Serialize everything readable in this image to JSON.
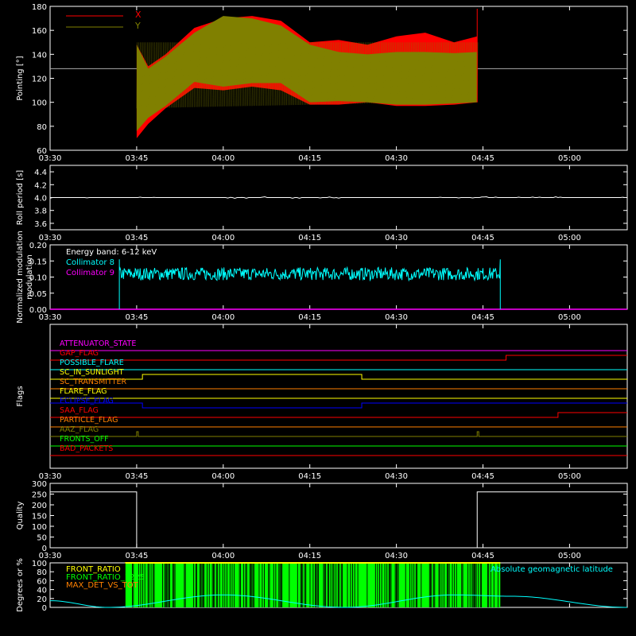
{
  "x_tick_labels": [
    "03:30",
    "03:45",
    "04:00",
    "04:15",
    "04:30",
    "04:45",
    "05:00"
  ],
  "colors": {
    "x_series": "#ff0000",
    "y_series": "#808000",
    "axis": "#ffffff",
    "collimator_8": "#00ffff",
    "collimator_9": "#ff00ff",
    "latitude": "#00ffff",
    "front_ratio": "#ffff00",
    "front_ratio_1225": "#00ff00",
    "max_det_vs_tot": "#ff8000"
  },
  "chart_data": [
    {
      "type": "line",
      "ylabel": "Pointing [°]",
      "ylim": [
        60,
        180
      ],
      "y_ticks": [
        "60",
        "80",
        "100",
        "120",
        "140",
        "160",
        "180"
      ],
      "x": [
        "03:30",
        "05:10"
      ],
      "reference_line": 128,
      "legend": [
        "X",
        "Y"
      ],
      "series": [
        {
          "name": "X",
          "x": [
            "03:45",
            "03:47",
            "03:50",
            "03:55",
            "04:00",
            "04:05",
            "04:10",
            "04:15",
            "04:20",
            "04:25",
            "04:30",
            "04:35",
            "04:40",
            "04:44"
          ],
          "upper": [
            148,
            130,
            140,
            162,
            170,
            172,
            168,
            150,
            152,
            148,
            155,
            158,
            150,
            155
          ],
          "lower": [
            70,
            82,
            95,
            112,
            110,
            113,
            110,
            98,
            98,
            100,
            97,
            97,
            98,
            100
          ]
        },
        {
          "name": "Y",
          "x": [
            "03:45",
            "03:47",
            "03:50",
            "03:55",
            "04:00",
            "04:05",
            "04:10",
            "04:15",
            "04:20",
            "04:25",
            "04:30",
            "04:35",
            "04:40",
            "04:44"
          ],
          "upper": [
            148,
            128,
            138,
            158,
            172,
            170,
            164,
            148,
            142,
            140,
            142,
            142,
            141,
            142
          ],
          "lower": [
            76,
            87,
            97,
            117,
            113,
            116,
            116,
            100,
            101,
            100,
            98,
            98,
            99,
            100
          ]
        }
      ]
    },
    {
      "type": "line",
      "ylabel": "Roll period [s]",
      "ylim": [
        3.5,
        4.5
      ],
      "y_ticks": [
        "3.6",
        "3.8",
        "4.0",
        "4.2",
        "4.4"
      ],
      "series": [
        {
          "x": [
            "03:30",
            "05:10"
          ],
          "values": [
            4.0,
            4.0
          ]
        }
      ]
    },
    {
      "type": "line",
      "ylabel": "Normalized modulation",
      "ylim": [
        0,
        0.2
      ],
      "y_ticks": [
        "0.00",
        "0.05",
        "0.10",
        "0.15",
        "0.20"
      ],
      "annotation": "Energy band: 6-12 keV",
      "series": [
        {
          "name": "Collimator 8",
          "x_start": "03:42",
          "x_end": "04:48",
          "mean": 0.11,
          "spread": 0.02
        },
        {
          "name": "Collimator 9",
          "value": 0.0
        }
      ]
    },
    {
      "type": "line",
      "ylabel": "Flags",
      "flags": [
        {
          "name": "ATTENUATOR_STATE",
          "color": "#ff00ff",
          "steps": [
            [
              0,
              0
            ]
          ]
        },
        {
          "name": "GAP_FLAG",
          "color": "#ff0000",
          "steps": [
            [
              0,
              0
            ],
            [
              1.0,
              1
            ]
          ]
        },
        {
          "name": "POSSIBLE_FLARE",
          "color": "#00ffff",
          "steps": [
            [
              0,
              0
            ]
          ]
        },
        {
          "name": "SC_IN_SUNLIGHT",
          "color": "#ffff00",
          "steps": [
            [
              0,
              0
            ],
            [
              0.3,
              1
            ],
            [
              0.8,
              0
            ]
          ]
        },
        {
          "name": "SC_TRANSMITTER",
          "color": "#ff8000",
          "steps": [
            [
              0,
              0
            ]
          ]
        },
        {
          "name": "FLARE_FLAG",
          "color": "#ffff00",
          "steps": [
            [
              0,
              0
            ]
          ]
        },
        {
          "name": "ECLIPSE_FLAG",
          "color": "#0000ff",
          "steps": [
            [
              0,
              1
            ],
            [
              0.3,
              0
            ],
            [
              0.8,
              1
            ]
          ]
        },
        {
          "name": "SAA_FLAG",
          "color": "#ff0000",
          "steps": [
            [
              0,
              0
            ],
            [
              1.23,
              1
            ]
          ]
        },
        {
          "name": "PARTICLE_FLAG",
          "color": "#ff8000",
          "steps": [
            [
              0,
              0
            ]
          ]
        },
        {
          "name": "AAZ_FLAG",
          "color": "#808000",
          "pulses": [
            0.3,
            0.8
          ]
        },
        {
          "name": "FRONTS_OFF",
          "color": "#00ff00",
          "steps": [
            [
              0,
              0
            ]
          ]
        },
        {
          "name": "BAD_PACKETS",
          "color": "#ff0000",
          "steps": [
            [
              0,
              0
            ]
          ]
        }
      ]
    },
    {
      "type": "line",
      "ylabel": "Quality",
      "ylim": [
        0,
        300
      ],
      "y_ticks": [
        "0",
        "50",
        "100",
        "150",
        "200",
        "250",
        "300"
      ],
      "series": [
        {
          "x": [
            "03:30",
            "03:45",
            "03:45",
            "04:44",
            "04:44",
            "05:10"
          ],
          "values": [
            260,
            260,
            0,
            0,
            260,
            260
          ]
        }
      ]
    },
    {
      "type": "line",
      "ylabel": "Degrees or %",
      "ylim": [
        0,
        100
      ],
      "y_ticks": [
        "0",
        "20",
        "40",
        "60",
        "80",
        "100"
      ],
      "legend": [
        "FRONT_RATIO",
        "FRONT_RATIO_1225",
        "MAX_DET_VS_TOT"
      ],
      "annotation": "Absolute geomagnetic latitude",
      "series": [
        {
          "name": "Absolute geomagnetic latitude",
          "x": [
            "03:30",
            "03:40",
            "04:00",
            "04:21",
            "04:40",
            "04:50",
            "05:10"
          ],
          "values": [
            15,
            0,
            28,
            0,
            28,
            25,
            0
          ]
        },
        {
          "name": "FRONT_RATIO_1225",
          "x_start": "03:43",
          "x_end": "04:48",
          "value": 100
        }
      ]
    }
  ]
}
